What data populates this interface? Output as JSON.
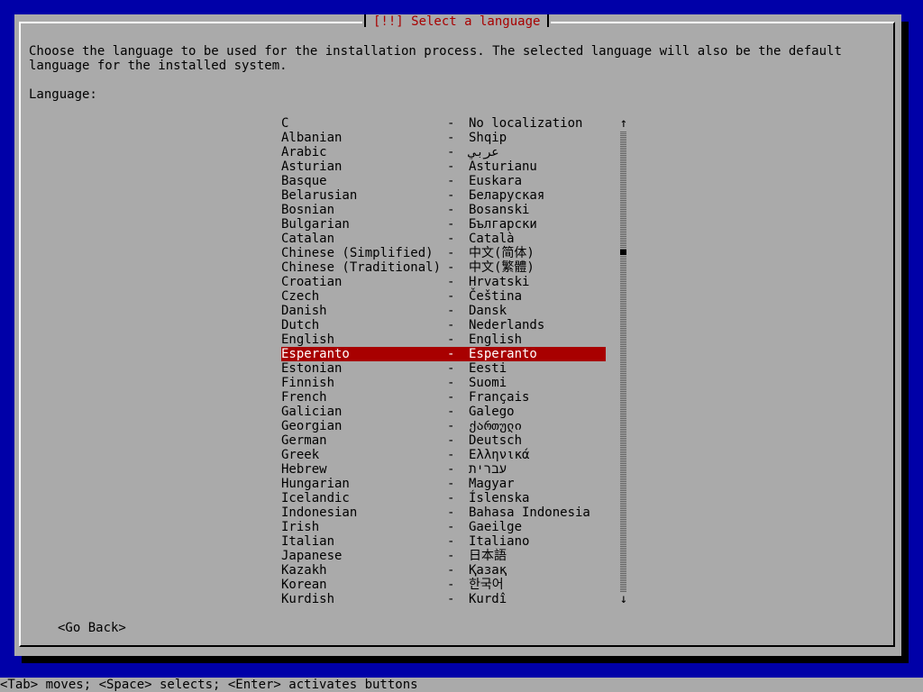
{
  "dialog": {
    "title": "[!!] Select a language",
    "description": "Choose the language to be used for the installation process. The selected language will also be the default language for the installed system.",
    "field_label": "Language:",
    "go_back_label": "<Go Back>"
  },
  "languages": [
    {
      "name": "C",
      "native": "No localization"
    },
    {
      "name": "Albanian",
      "native": "Shqip"
    },
    {
      "name": "Arabic",
      "native": "عربي"
    },
    {
      "name": "Asturian",
      "native": "Asturianu"
    },
    {
      "name": "Basque",
      "native": "Euskara"
    },
    {
      "name": "Belarusian",
      "native": "Беларуская"
    },
    {
      "name": "Bosnian",
      "native": "Bosanski"
    },
    {
      "name": "Bulgarian",
      "native": "Български"
    },
    {
      "name": "Catalan",
      "native": "Català"
    },
    {
      "name": "Chinese (Simplified)",
      "native": "中文(简体)"
    },
    {
      "name": "Chinese (Traditional)",
      "native": "中文(繁體)"
    },
    {
      "name": "Croatian",
      "native": "Hrvatski"
    },
    {
      "name": "Czech",
      "native": "Čeština"
    },
    {
      "name": "Danish",
      "native": "Dansk"
    },
    {
      "name": "Dutch",
      "native": "Nederlands"
    },
    {
      "name": "English",
      "native": "English"
    },
    {
      "name": "Esperanto",
      "native": "Esperanto",
      "selected": true
    },
    {
      "name": "Estonian",
      "native": "Eesti"
    },
    {
      "name": "Finnish",
      "native": "Suomi"
    },
    {
      "name": "French",
      "native": "Français"
    },
    {
      "name": "Galician",
      "native": "Galego"
    },
    {
      "name": "Georgian",
      "native": "ქართული"
    },
    {
      "name": "German",
      "native": "Deutsch"
    },
    {
      "name": "Greek",
      "native": "Ελληνικά"
    },
    {
      "name": "Hebrew",
      "native": "עברית"
    },
    {
      "name": "Hungarian",
      "native": "Magyar"
    },
    {
      "name": "Icelandic",
      "native": "Íslenska"
    },
    {
      "name": "Indonesian",
      "native": "Bahasa Indonesia"
    },
    {
      "name": "Irish",
      "native": "Gaeilge"
    },
    {
      "name": "Italian",
      "native": "Italiano"
    },
    {
      "name": "Japanese",
      "native": "日本語"
    },
    {
      "name": "Kazakh",
      "native": "Қазақ"
    },
    {
      "name": "Korean",
      "native": "한국어"
    },
    {
      "name": "Kurdish",
      "native": "Kurdî"
    }
  ],
  "separator": "-",
  "scrollbar": {
    "up_arrow": "↑",
    "down_arrow": "↓"
  },
  "hint_bar": "<Tab> moves; <Space> selects; <Enter> activates buttons",
  "colors": {
    "background": "#0000a8",
    "dialog": "#aaaaaa",
    "title": "#a80000",
    "selection": "#a80000",
    "selection_text": "#ffffff"
  }
}
